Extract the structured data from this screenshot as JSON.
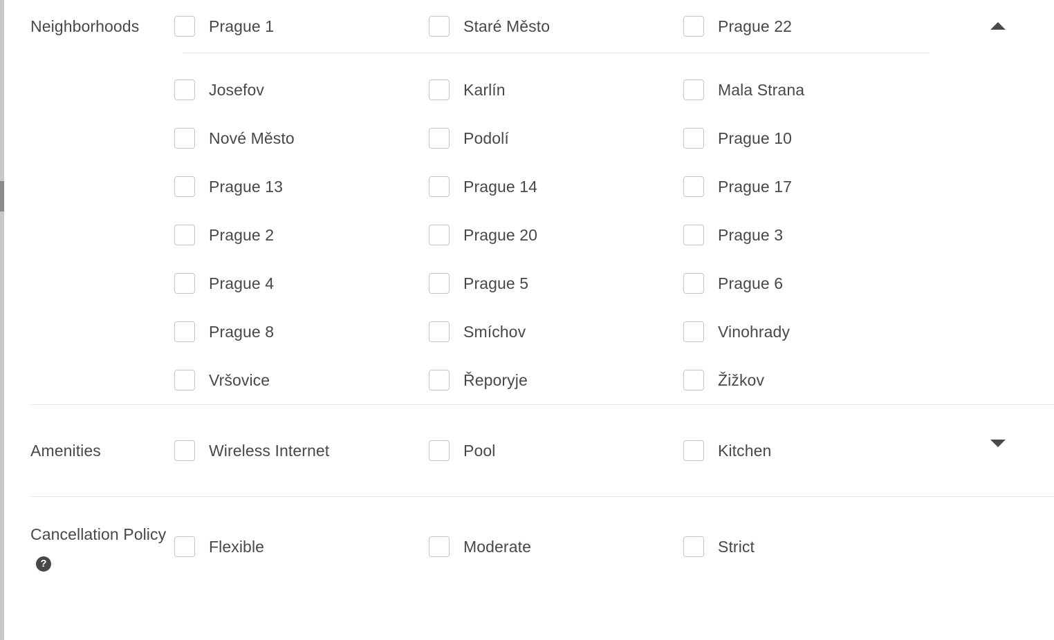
{
  "scrollbar": {
    "name": "vertical-scrollbar"
  },
  "sections": [
    {
      "id": "neighborhoods",
      "label": "Neighborhoods",
      "expanded": true,
      "toggle_icon": "chevron-up-icon",
      "header_row": [
        "Prague 1",
        "Staré Město",
        "Prague 22"
      ],
      "rows": [
        [
          "Josefov",
          "Karlín",
          "Mala Strana"
        ],
        [
          "Nové Město",
          "Podolí",
          "Prague 10"
        ],
        [
          "Prague 13",
          "Prague 14",
          "Prague 17"
        ],
        [
          "Prague 2",
          "Prague 20",
          "Prague 3"
        ],
        [
          "Prague 4",
          "Prague 5",
          "Prague 6"
        ],
        [
          "Prague 8",
          "Smíchov",
          "Vinohrady"
        ],
        [
          "Vršovice",
          "Řeporyje",
          "Žižkov"
        ]
      ]
    },
    {
      "id": "amenities",
      "label": "Amenities",
      "expanded": false,
      "toggle_icon": "chevron-down-icon",
      "header_row": [
        "Wireless Internet",
        "Pool",
        "Kitchen"
      ],
      "rows": []
    },
    {
      "id": "cancellation",
      "label": "Cancellation Policy",
      "help_icon": "?",
      "expanded": false,
      "toggle_icon": "",
      "header_row": [
        "Flexible",
        "Moderate",
        "Strict"
      ],
      "rows": []
    }
  ],
  "colors": {
    "text": "#484848",
    "checkbox_border": "#c4c4c4",
    "divider": "#e8e8e8",
    "arrow": "#4a4a4a",
    "help_badge": "#484848"
  }
}
